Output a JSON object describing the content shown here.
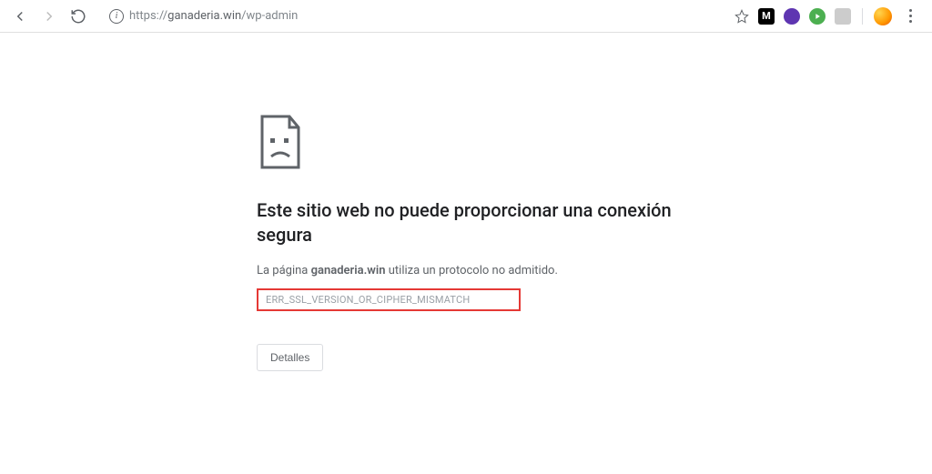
{
  "toolbar": {
    "url_scheme": "https://",
    "url_domain": "ganaderia.win",
    "url_path": "/wp-admin",
    "info_glyph": "i"
  },
  "extensions": {
    "m_label": "M",
    "k_label": ""
  },
  "error": {
    "title": "Este sitio web no puede proporcionar una conexión segura",
    "desc_prefix": "La página ",
    "desc_domain": "ganaderia.win",
    "desc_suffix": " utiliza un protocolo no admitido.",
    "code": "ERR_SSL_VERSION_OR_CIPHER_MISMATCH",
    "details_label": "Detalles"
  }
}
